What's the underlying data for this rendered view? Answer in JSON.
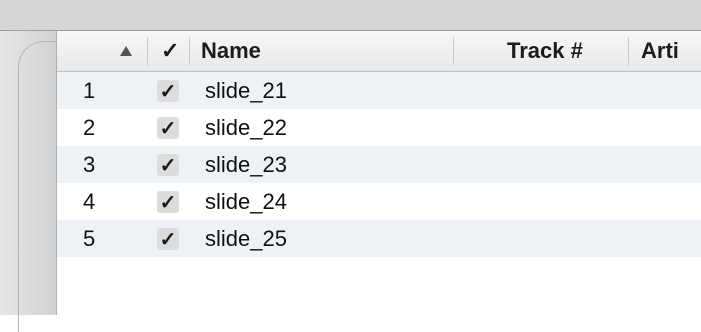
{
  "header": {
    "sort_icon": "sort-ascending-icon",
    "check_label": "✓",
    "name_label": "Name",
    "track_label": "Track #",
    "artist_label": "Arti"
  },
  "rows": [
    {
      "num": "1",
      "check": "✓",
      "name": "slide_21"
    },
    {
      "num": "2",
      "check": "✓",
      "name": "slide_22"
    },
    {
      "num": "3",
      "check": "✓",
      "name": "slide_23"
    },
    {
      "num": "4",
      "check": "✓",
      "name": "slide_24"
    },
    {
      "num": "5",
      "check": "✓",
      "name": "slide_25"
    }
  ],
  "colors": {
    "row_alt": "#eef2f7",
    "header_bg": "#eeeeee",
    "top_strip": "#d6d6d6"
  }
}
